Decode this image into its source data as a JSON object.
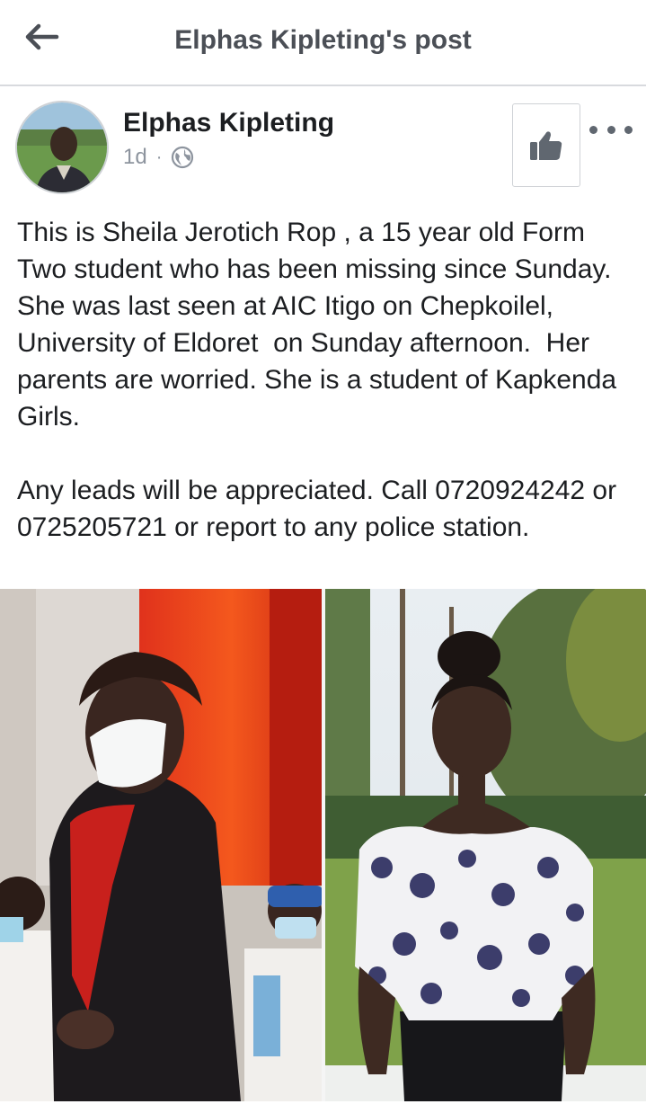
{
  "topbar": {
    "title": "Elphas Kipleting's post",
    "back_icon": "arrow-left-icon"
  },
  "post": {
    "author_name": "Elphas Kipleting",
    "time": "1d",
    "separator": "·",
    "audience_icon": "globe-icon",
    "like_icon": "thumbs-up-icon",
    "more_icon": "more-dots-icon",
    "paragraphs": [
      "This is Sheila Jerotich Rop , a 15 year old Form Two student who has been missing since Sunday. She was last seen at AIC Itigo on Chepkoilel, University of Eldoret  on Sunday afternoon.  Her parents are worried. She is a student of Kapkenda Girls.",
      "Any leads will be appreciated. Call 0720924242 or 0725205721 or report to any police station."
    ]
  },
  "colors": {
    "title_gray": "#4b4f56",
    "meta_gray": "#8d949e",
    "icon_gray": "#606770",
    "divider": "#d8dade"
  }
}
